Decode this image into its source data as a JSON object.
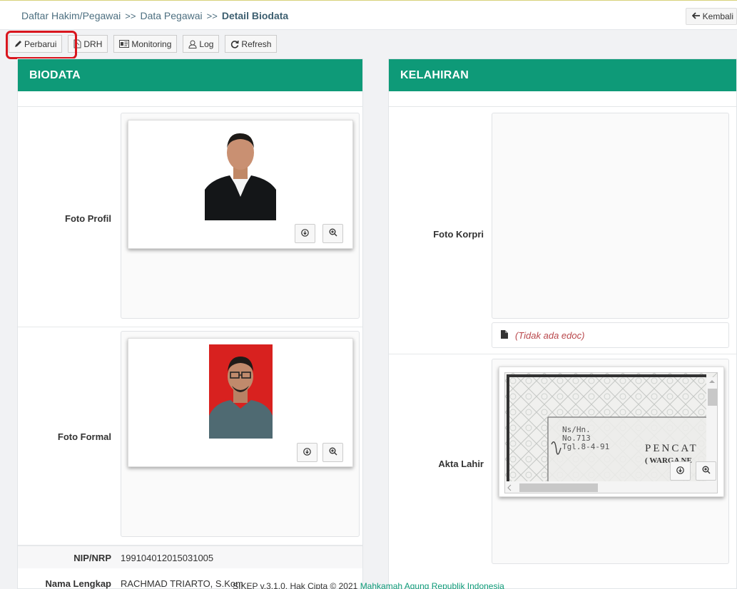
{
  "breadcrumb": {
    "item1": "Daftar Hakim/Pegawai",
    "item2": "Data Pegawai",
    "item3": "Detail Biodata",
    "separator": ">>"
  },
  "header": {
    "back_label": "Kembali"
  },
  "toolbar": {
    "update_label": "Perbarui",
    "drh_label": "DRH",
    "monitoring_label": "Monitoring",
    "log_label": "Log",
    "refresh_label": "Refresh"
  },
  "biodata": {
    "title": "BIODATA",
    "profile_photo_label": "Foto Profil",
    "formal_photo_label": "Foto Formal",
    "nip_label": "NIP/NRP",
    "nip_value": "199104012015031005",
    "name_label": "Nama Lengkap",
    "name_value": "RACHMAD TRIARTO, S.Kom"
  },
  "kelahiran": {
    "title": "KELAHIRAN",
    "korpri_photo_label": "Foto Korpri",
    "no_edoc_text": "(Tidak ada edoc)",
    "birth_cert_label": "Akta Lahir",
    "doc_lines": [
      "Ns/Hn.",
      "No.713",
      "Tgl.8-4-91"
    ],
    "doc_title": "PENCAT",
    "doc_subtitle": "( WARGA NE"
  },
  "footer": {
    "copyright": "SIKEP v.3.1.0, Hak Cipta © 2021",
    "org": "Mahkamah Agung Republik Indonesia"
  },
  "colors": {
    "accent": "#0e9a78",
    "highlight": "#d9161e"
  }
}
